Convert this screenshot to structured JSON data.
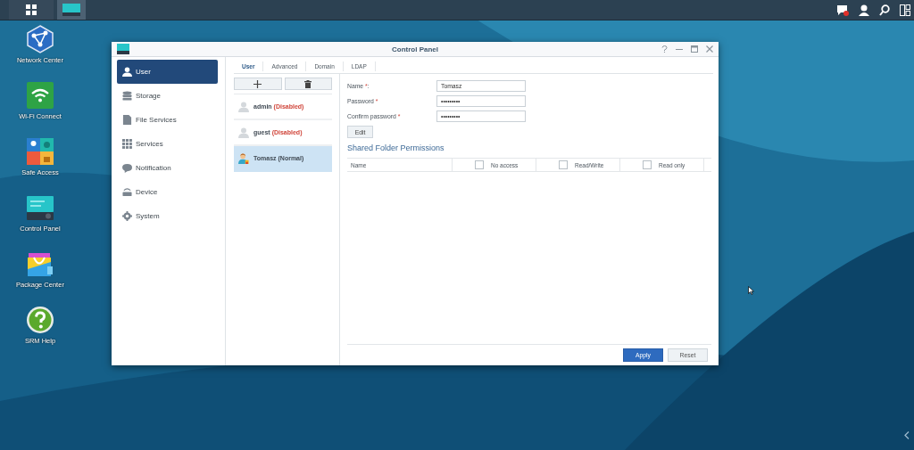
{
  "taskbar": {
    "apps": [
      {
        "kind": "main-menu",
        "selected": false
      },
      {
        "kind": "control-panel",
        "selected": true
      }
    ],
    "notification": {
      "unread": true
    }
  },
  "desktop_icons": [
    {
      "kind": "network",
      "label": "Network Center"
    },
    {
      "kind": "wifi",
      "label": "Wi-Fi Connect"
    },
    {
      "kind": "safe",
      "label": "Safe Access"
    },
    {
      "kind": "control-panel",
      "label": "Control Panel"
    },
    {
      "kind": "package",
      "label": "Package Center"
    },
    {
      "kind": "help",
      "label": "SRM Help"
    }
  ],
  "window": {
    "title": "Control Panel",
    "sidebar": {
      "items": [
        {
          "kind": "user",
          "label": "User",
          "selected": true
        },
        {
          "kind": "storage",
          "label": "Storage",
          "selected": false
        },
        {
          "kind": "file",
          "label": "File Services",
          "selected": false
        },
        {
          "kind": "services",
          "label": "Services",
          "selected": false
        },
        {
          "kind": "notification",
          "label": "Notification",
          "selected": false
        },
        {
          "kind": "device",
          "label": "Device",
          "selected": false
        },
        {
          "kind": "system",
          "label": "System",
          "selected": false
        }
      ]
    },
    "tabs": [
      {
        "label": "User",
        "selected": true
      },
      {
        "label": "Advanced",
        "selected": false
      },
      {
        "label": "Domain",
        "selected": false
      },
      {
        "label": "LDAP",
        "selected": false
      }
    ],
    "users": [
      {
        "name": "admin",
        "status": "(Disabled)",
        "disabled": true,
        "selected": false
      },
      {
        "name": "guest",
        "status": "(Disabled)",
        "disabled": true,
        "selected": false
      },
      {
        "name": "Tomasz",
        "status": "(Normal)",
        "disabled": false,
        "selected": true
      }
    ],
    "form": {
      "fields": [
        {
          "label": "Name",
          "required_mark": "*",
          "suffix": ":",
          "value": "Tomasz"
        },
        {
          "label": "Password",
          "required_mark": "*",
          "value": "•••••••••"
        },
        {
          "label": "Confirm password",
          "required_mark": "*",
          "value": "•••••••••"
        }
      ],
      "edit_button": "Edit"
    },
    "permissions": {
      "title": "Shared Folder Permissions",
      "name_column": "Name",
      "columns": [
        {
          "label": "No access",
          "checked": false
        },
        {
          "label": "Read/Write",
          "checked": false
        },
        {
          "label": "Read only",
          "checked": false
        }
      ]
    },
    "buttons": [
      {
        "label": "Apply",
        "kind": "primary"
      },
      {
        "label": "Reset",
        "kind": "secondary"
      }
    ]
  }
}
